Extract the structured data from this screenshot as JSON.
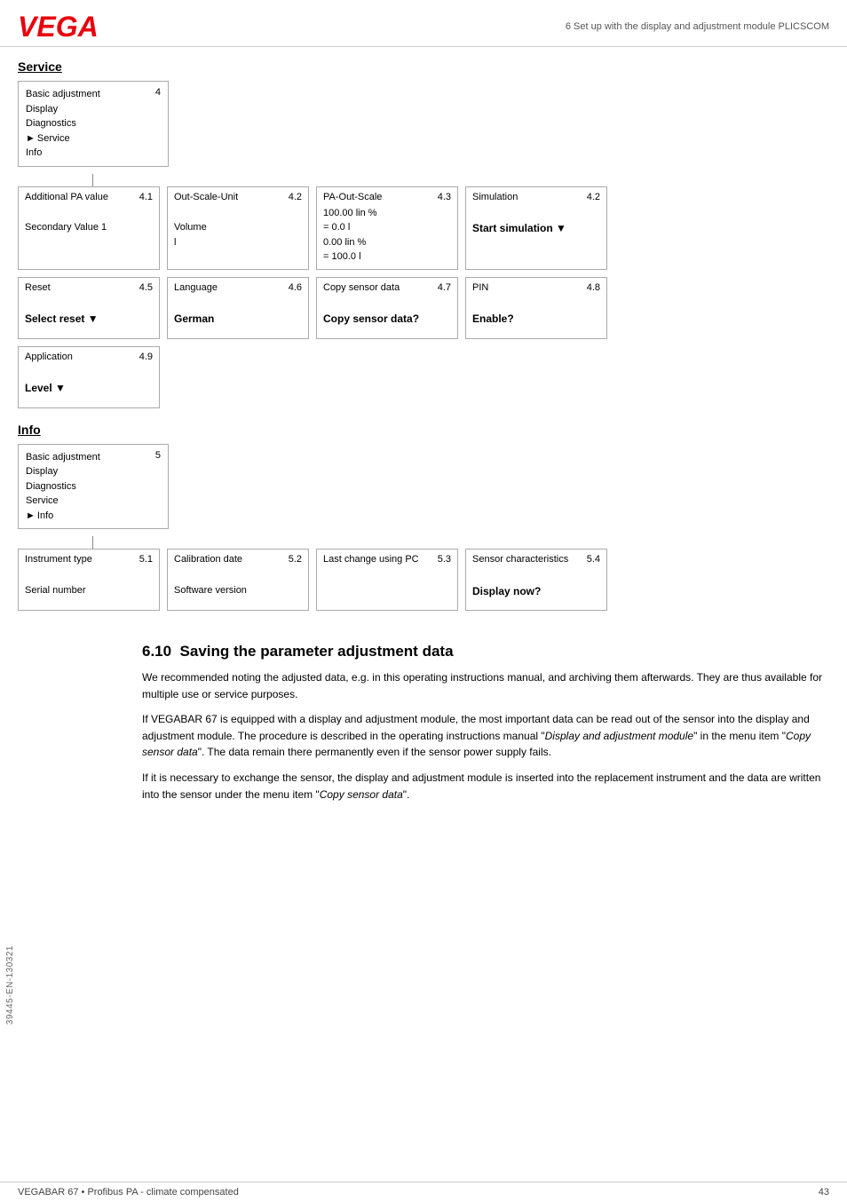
{
  "header": {
    "logo": "VEGA",
    "subtitle": "6 Set up with the display and adjustment module PLICSCOM"
  },
  "service_section": {
    "title": "Service",
    "menu_box": {
      "number": "4",
      "items": [
        "Basic adjustment",
        "Display",
        "Diagnostics",
        "► Service",
        "Info"
      ]
    },
    "row1": [
      {
        "title": "Additional PA value",
        "number": "4.1",
        "lines": [
          "",
          "Secondary Value 1"
        ],
        "bold": false
      },
      {
        "title": "Out-Scale-Unit",
        "number": "4.2",
        "lines": [
          "",
          "Volume",
          "l"
        ],
        "bold": false
      },
      {
        "title": "PA-Out-Scale",
        "number": "4.3",
        "lines": [
          "100.00 lin %",
          "= 0.0 l",
          "0.00 lin %",
          "= 100.0 l"
        ],
        "bold": false
      },
      {
        "title": "Simulation",
        "number": "4.2",
        "lines": [
          ""
        ],
        "bold_line": "Start simulation ▼",
        "bold": true
      }
    ],
    "row2": [
      {
        "title": "Reset",
        "number": "4.5",
        "lines": [
          ""
        ],
        "bold_line": "Select reset ▼",
        "bold": true
      },
      {
        "title": "Language",
        "number": "4.6",
        "lines": [
          ""
        ],
        "bold_line": "German",
        "bold": true
      },
      {
        "title": "Copy sensor data",
        "number": "4.7",
        "lines": [
          ""
        ],
        "bold_line": "Copy sensor data?",
        "bold": true
      },
      {
        "title": "PIN",
        "number": "4.8",
        "lines": [
          ""
        ],
        "bold_line": "Enable?",
        "bold": true
      }
    ],
    "row3": [
      {
        "title": "Application",
        "number": "4.9",
        "lines": [
          ""
        ],
        "bold_line": "Level ▼",
        "bold": true
      }
    ]
  },
  "info_section": {
    "title": "Info",
    "menu_box": {
      "number": "5",
      "items": [
        "Basic adjustment",
        "Display",
        "Diagnostics",
        "Service",
        "► Info"
      ]
    },
    "row1": [
      {
        "title": "Instrument type",
        "number": "5.1",
        "lines": [
          "",
          "Serial number"
        ],
        "bold": false
      },
      {
        "title": "Calibration date",
        "number": "5.2",
        "lines": [
          "",
          "Software version"
        ],
        "bold": false
      },
      {
        "title": "Last change using PC",
        "number": "5.3",
        "lines": [
          ""
        ],
        "bold": false
      },
      {
        "title": "Sensor characteristics",
        "number": "5.4",
        "lines": [
          ""
        ],
        "bold_line": "Display now?",
        "bold": true
      }
    ]
  },
  "article": {
    "number": "6.10",
    "title": "Saving the parameter adjustment data",
    "paragraphs": [
      "We recommended noting the adjusted data, e.g. in this operating instructions manual, and archiving them afterwards. They are thus available for multiple use or service purposes.",
      "If VEGABAR 67 is equipped with a display and adjustment module, the most important data can be read out of the sensor into the display and adjustment module. The procedure is described in the operating instructions manual \"Display and adjustment module\" in the menu item \"Copy sensor data\". The data remain there permanently even if the sensor power supply fails.",
      "If it is necessary to exchange the sensor, the display and adjustment module is inserted into the replacement instrument and the data are written into the sensor under the menu item \"Copy sensor data\"."
    ]
  },
  "footer": {
    "left": "VEGABAR 67 • Profibus PA - climate compensated",
    "right": "43",
    "side": "39445-EN-130321"
  }
}
